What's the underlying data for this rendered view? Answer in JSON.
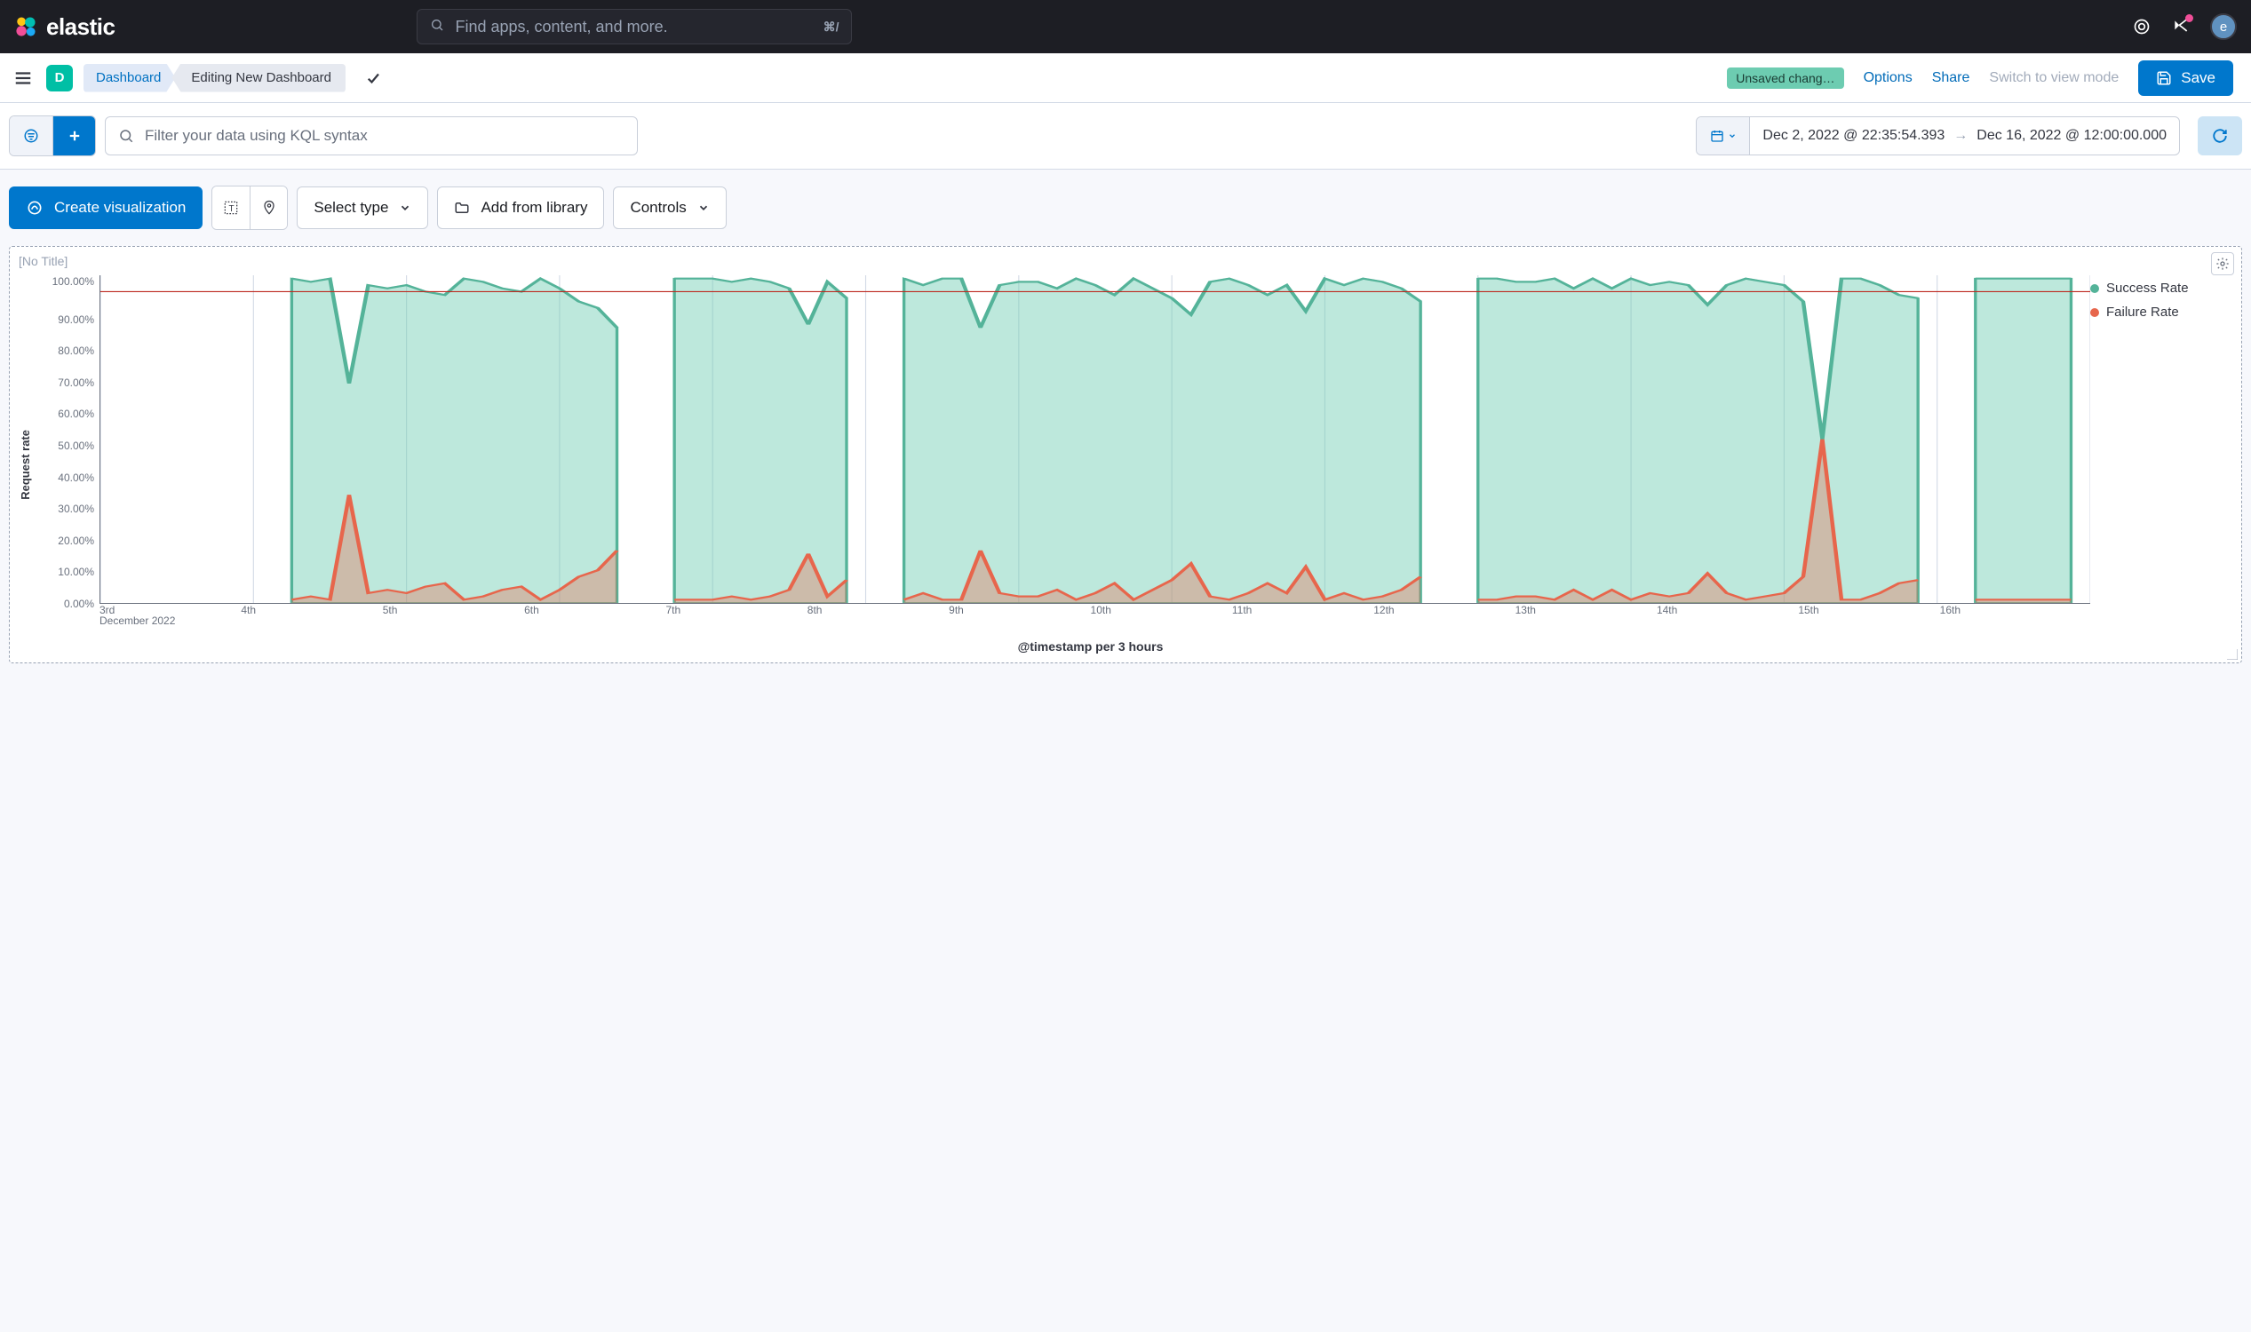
{
  "header": {
    "brand": "elastic",
    "search_placeholder": "Find apps, content, and more.",
    "search_shortcut": "⌘/",
    "avatar_initial": "e"
  },
  "appbar": {
    "space_initial": "D",
    "crumb1": "Dashboard",
    "crumb2": "Editing New Dashboard",
    "unsaved": "Unsaved chang…",
    "options": "Options",
    "share": "Share",
    "view_mode": "Switch to view mode",
    "save": "Save"
  },
  "query": {
    "kql_placeholder": "Filter your data using KQL syntax",
    "time_start": "Dec 2, 2022 @ 22:35:54.393",
    "time_end": "Dec 16, 2022 @ 12:00:00.000"
  },
  "toolbar": {
    "create_viz": "Create visualization",
    "select_type": "Select type",
    "add_library": "Add from library",
    "controls": "Controls"
  },
  "panel": {
    "title": "[No Title]"
  },
  "chart_data": {
    "type": "area",
    "title": "",
    "xlabel": "@timestamp per 3 hours",
    "ylabel": "Request rate",
    "ylim": [
      0,
      100
    ],
    "y_ticks": [
      "100.00%",
      "90.00%",
      "80.00%",
      "70.00%",
      "60.00%",
      "50.00%",
      "40.00%",
      "30.00%",
      "20.00%",
      "10.00%",
      "0.00%"
    ],
    "x_ticks": [
      "3rd",
      "4th",
      "5th",
      "6th",
      "7th",
      "8th",
      "9th",
      "10th",
      "11th",
      "12th",
      "13th",
      "14th",
      "15th",
      "16th"
    ],
    "x_sublabel": "December 2022",
    "threshold_line": 95,
    "legend": [
      {
        "name": "Success Rate",
        "color": "#6dccb1"
      },
      {
        "name": "Failure Rate",
        "color": "#e7664c"
      }
    ],
    "series": [
      {
        "name": "Success Rate",
        "color": "#6dccb1",
        "x": [
          10,
          11,
          12,
          13,
          14,
          15,
          16,
          17,
          18,
          19,
          20,
          21,
          22,
          23,
          24,
          25,
          26,
          27,
          30,
          31,
          32,
          33,
          34,
          35,
          36,
          37,
          38,
          39,
          42,
          43,
          44,
          45,
          46,
          47,
          48,
          49,
          50,
          51,
          52,
          53,
          54,
          55,
          56,
          57,
          58,
          59,
          60,
          61,
          62,
          63,
          64,
          65,
          66,
          67,
          68,
          69,
          72,
          73,
          74,
          75,
          76,
          77,
          78,
          79,
          80,
          81,
          82,
          83,
          84,
          85,
          86,
          87,
          88,
          89,
          90,
          91,
          92,
          93,
          94,
          95,
          98,
          99,
          100,
          101,
          102,
          103
        ],
        "values": [
          99,
          98,
          99,
          67,
          97,
          96,
          97,
          95,
          94,
          99,
          98,
          96,
          95,
          99,
          96,
          92,
          90,
          84,
          99,
          99,
          99,
          98,
          99,
          98,
          96,
          85,
          98,
          93,
          99,
          97,
          99,
          99,
          84,
          97,
          98,
          98,
          96,
          99,
          97,
          94,
          99,
          96,
          93,
          88,
          98,
          99,
          97,
          94,
          97,
          89,
          99,
          97,
          99,
          98,
          96,
          92,
          99,
          99,
          98,
          98,
          99,
          96,
          99,
          96,
          99,
          97,
          98,
          97,
          91,
          97,
          99,
          98,
          97,
          92,
          50,
          99,
          99,
          97,
          94,
          93,
          99,
          99,
          99,
          99,
          99,
          99
        ]
      },
      {
        "name": "Failure Rate",
        "color": "#e7664c",
        "x": [
          10,
          11,
          12,
          13,
          14,
          15,
          16,
          17,
          18,
          19,
          20,
          21,
          22,
          23,
          24,
          25,
          26,
          27,
          30,
          31,
          32,
          33,
          34,
          35,
          36,
          37,
          38,
          39,
          42,
          43,
          44,
          45,
          46,
          47,
          48,
          49,
          50,
          51,
          52,
          53,
          54,
          55,
          56,
          57,
          58,
          59,
          60,
          61,
          62,
          63,
          64,
          65,
          66,
          67,
          68,
          69,
          72,
          73,
          74,
          75,
          76,
          77,
          78,
          79,
          80,
          81,
          82,
          83,
          84,
          85,
          86,
          87,
          88,
          89,
          90,
          91,
          92,
          93,
          94,
          95,
          98,
          99,
          100,
          101,
          102,
          103
        ],
        "values": [
          1,
          2,
          1,
          33,
          3,
          4,
          3,
          5,
          6,
          1,
          2,
          4,
          5,
          1,
          4,
          8,
          10,
          16,
          1,
          1,
          1,
          2,
          1,
          2,
          4,
          15,
          2,
          7,
          1,
          3,
          1,
          1,
          16,
          3,
          2,
          2,
          4,
          1,
          3,
          6,
          1,
          4,
          7,
          12,
          2,
          1,
          3,
          6,
          3,
          11,
          1,
          3,
          1,
          2,
          4,
          8,
          1,
          1,
          2,
          2,
          1,
          4,
          1,
          4,
          1,
          3,
          2,
          3,
          9,
          3,
          1,
          2,
          3,
          8,
          50,
          1,
          1,
          3,
          6,
          7,
          1,
          1,
          1,
          1,
          1,
          1
        ]
      }
    ]
  }
}
